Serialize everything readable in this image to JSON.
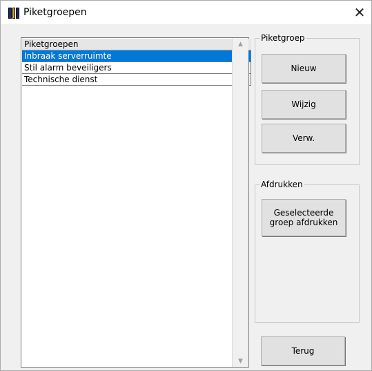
{
  "window": {
    "title": "Piketgroepen",
    "close_glyph": "✕",
    "app_icon": "app-window-icon"
  },
  "list": {
    "header": "Piketgroepen",
    "rows": [
      {
        "label": "Inbraak serverruimte",
        "selected": true
      },
      {
        "label": "Stil alarm beveiligers",
        "selected": false
      },
      {
        "label": "Technische dienst",
        "selected": false
      }
    ],
    "scroll_up_glyph": "▲",
    "scroll_down_glyph": "▼"
  },
  "piketgroep": {
    "legend": "Piketgroep",
    "new_label": "Nieuw",
    "edit_label": "Wijzig",
    "delete_label": "Verw."
  },
  "print": {
    "legend": "Afdrukken",
    "print_label": "Geselecteerde groep afdrukken"
  },
  "footer": {
    "back_label": "Terug"
  },
  "colors": {
    "selection": "#0078d7",
    "window_bg": "#f0f0f0"
  }
}
